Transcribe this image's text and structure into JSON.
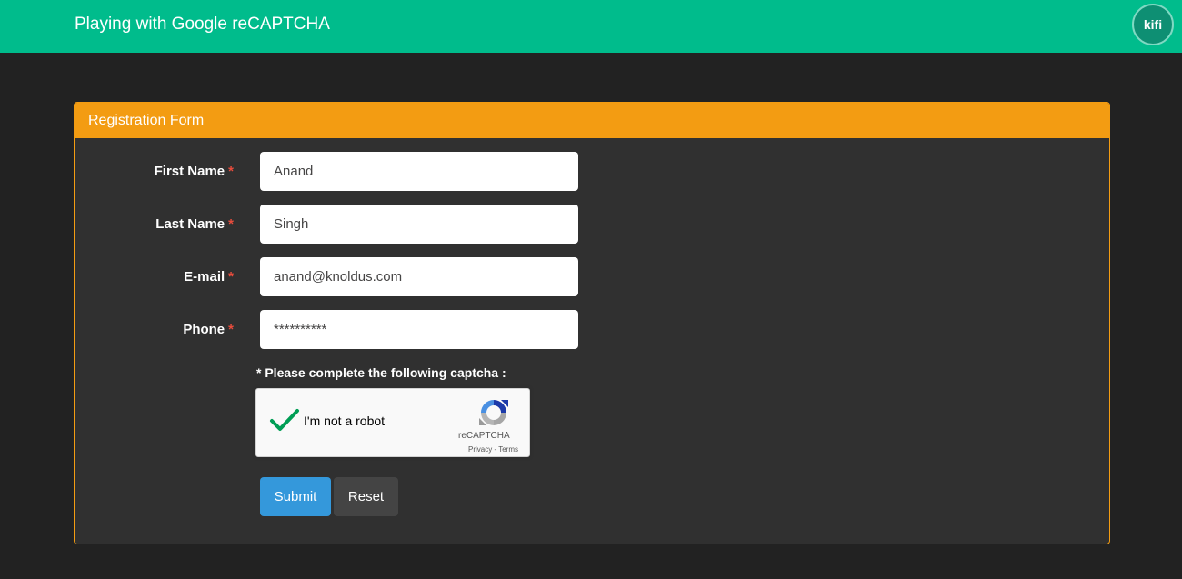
{
  "navbar": {
    "brand": "Playing with Google reCAPTCHA",
    "avatar_text": "kifi"
  },
  "panel": {
    "title": "Registration Form"
  },
  "form": {
    "fields": [
      {
        "label": "First Name",
        "required_mark": "*",
        "value": "Anand"
      },
      {
        "label": "Last Name",
        "required_mark": "*",
        "value": "Singh"
      },
      {
        "label": "E-mail",
        "required_mark": "*",
        "value": "anand@knoldus.com"
      },
      {
        "label": "Phone",
        "required_mark": "*",
        "value": "**********"
      }
    ],
    "captcha_note": "* Please complete the following captcha :",
    "submit_label": "Submit",
    "reset_label": "Reset"
  },
  "recaptcha": {
    "checkbox_label": "I'm not a robot",
    "checked": true,
    "brand": "reCAPTCHA",
    "privacy_label": "Privacy",
    "separator": " - ",
    "terms_label": "Terms"
  },
  "colors": {
    "navbar": "#00bc8c",
    "panel_header": "#f39c12",
    "submit": "#3498db",
    "reset": "#444444",
    "required": "#e74c3c",
    "checkmark": "#009e55"
  }
}
